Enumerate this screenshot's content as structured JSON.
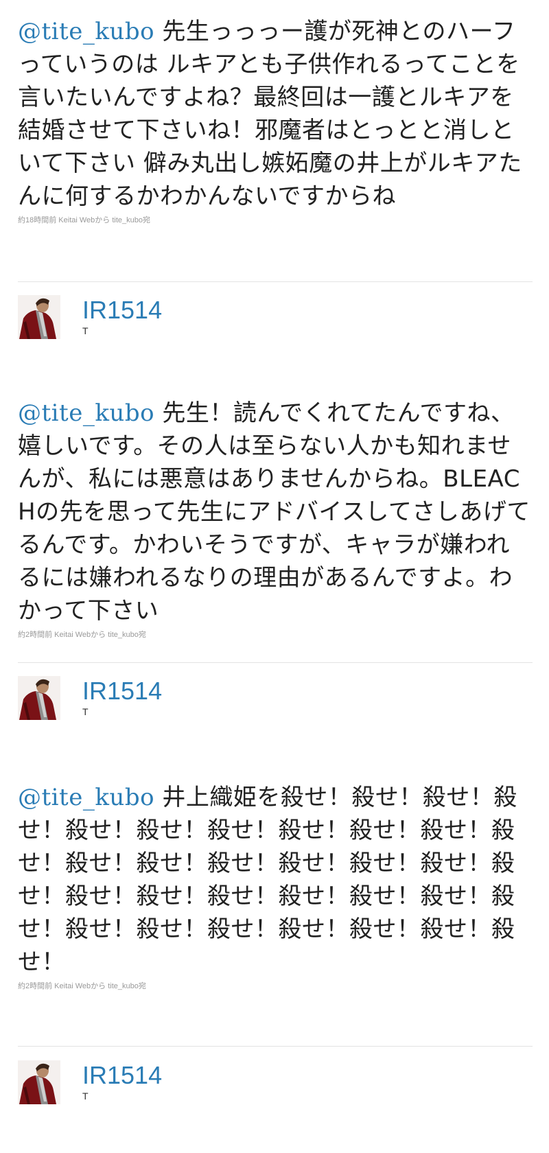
{
  "tweets": [
    {
      "mention": "@tite_kubo",
      "body": "先生っっっー護が死神とのハーフっていうのは ルキアとも子供作れるってことを言いたいんですよね？最終回は一護とルキアを結婚させて下さいね！邪魔者はとっとと消しといて下さい 僻み丸出し嫉妬魔の井上がルキアたんに何するかわかんないですからね",
      "meta": "約18時間前 Keitai Webから tite_kubo宛",
      "author": {
        "screen_name": "IR1514",
        "full_name": "T"
      }
    },
    {
      "mention": "@tite_kubo",
      "body": "先生！読んでくれてたんですね、嬉しいです。その人は至らない人かも知れませんが、私には悪意はありませんからね。BLEACHの先を思って先生にアドバイスしてさしあげてるんです。かわいそうですが、キャラが嫌われるには嫌われるなりの理由があるんですよ。わかって下さい",
      "meta": "約2時間前 Keitai Webから tite_kubo宛",
      "author": {
        "screen_name": "IR1514",
        "full_name": "T"
      }
    },
    {
      "mention": "@tite_kubo",
      "body": "井上織姫を殺せ！殺せ！殺せ！殺せ！殺せ！殺せ！殺せ！殺せ！殺せ！殺せ！殺せ！殺せ！殺せ！殺せ！殺せ！殺せ！殺せ！殺せ！殺せ！殺せ！殺せ！殺せ！殺せ！殺せ！殺せ！殺せ！殺せ！殺せ！殺せ！殺せ！殺せ！殺せ！",
      "meta": "約2時間前 Keitai Webから tite_kubo宛",
      "author": {
        "screen_name": "IR1514",
        "full_name": "T"
      }
    }
  ],
  "colors": {
    "link": "#2a7cb5",
    "text": "#222222",
    "meta": "#999999",
    "divider": "#e3e3e3"
  },
  "icons": {
    "avatar": "user-avatar-icon"
  }
}
